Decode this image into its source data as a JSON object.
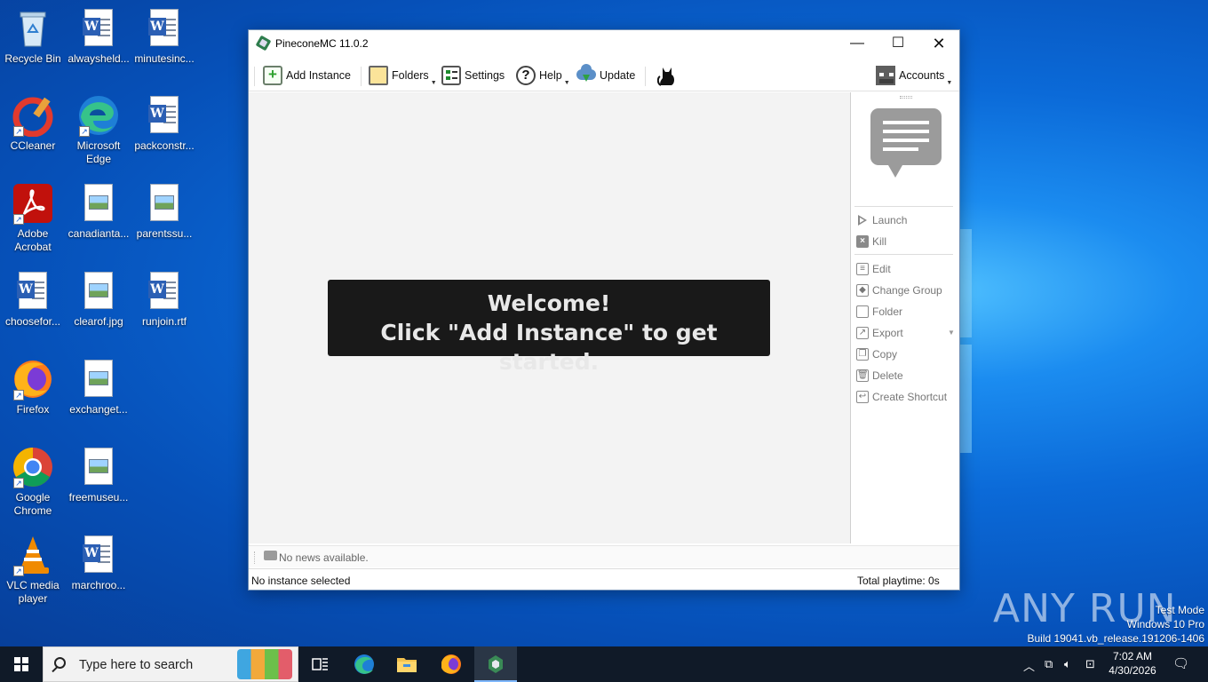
{
  "desktop_icons": [
    {
      "label": "Recycle Bin",
      "icon": "recycle-bin-icon"
    },
    {
      "label": "alwaysheld...",
      "icon": "word-doc-icon"
    },
    {
      "label": "minutesinc...",
      "icon": "word-doc-icon"
    },
    {
      "label": "CCleaner",
      "icon": "ccleaner-icon"
    },
    {
      "label": "Microsoft Edge",
      "icon": "edge-icon"
    },
    {
      "label": "packconstr...",
      "icon": "word-doc-icon"
    },
    {
      "label": "Adobe Acrobat",
      "icon": "acrobat-icon"
    },
    {
      "label": "canadianta...",
      "icon": "image-file-icon"
    },
    {
      "label": "parentssu...",
      "icon": "image-file-icon"
    },
    {
      "label": "choosefor...",
      "icon": "word-doc-icon"
    },
    {
      "label": "clearof.jpg",
      "icon": "image-file-icon"
    },
    {
      "label": "runjoin.rtf",
      "icon": "word-doc-icon"
    },
    {
      "label": "Firefox",
      "icon": "firefox-icon"
    },
    {
      "label": "exchanget...",
      "icon": "image-file-icon"
    },
    {
      "label": "Google Chrome",
      "icon": "chrome-icon"
    },
    {
      "label": "freemuseu...",
      "icon": "image-file-icon"
    },
    {
      "label": "VLC media player",
      "icon": "vlc-icon"
    },
    {
      "label": "marchroo...",
      "icon": "word-doc-icon"
    }
  ],
  "window": {
    "title": "PineconeMC 11.0.2",
    "controls": {
      "minimize": "—",
      "maximize": "☐",
      "close": "✕"
    },
    "toolbar": {
      "add_instance": "Add Instance",
      "folders": "Folders",
      "settings": "Settings",
      "help": "Help",
      "update": "Update",
      "accounts": "Accounts",
      "help_glyph": "?"
    },
    "welcome": {
      "line1": "Welcome!",
      "line2": "Click \"Add Instance\" to get started."
    },
    "sidebar": {
      "launch": "Launch",
      "kill": "Kill",
      "edit": "Edit",
      "change_group": "Change Group",
      "folder": "Folder",
      "export": "Export",
      "copy": "Copy",
      "delete": "Delete",
      "create_shortcut": "Create Shortcut"
    },
    "news": "No news available.",
    "status": {
      "selection": "No instance selected",
      "playtime": "Total playtime: 0s"
    }
  },
  "watermark": {
    "brand": "ANY RUN",
    "mode": "Test Mode",
    "os": "Windows 10 Pro",
    "build": "Build 19041.vb_release.191206-1406"
  },
  "taskbar": {
    "search_placeholder": "Type here to search",
    "time": "7:02 AM",
    "date": "4/30/2026"
  },
  "colors": {
    "desktop_blue": "#0b6ad8",
    "welcome_bg": "#191919",
    "taskbar": "#101a28"
  }
}
